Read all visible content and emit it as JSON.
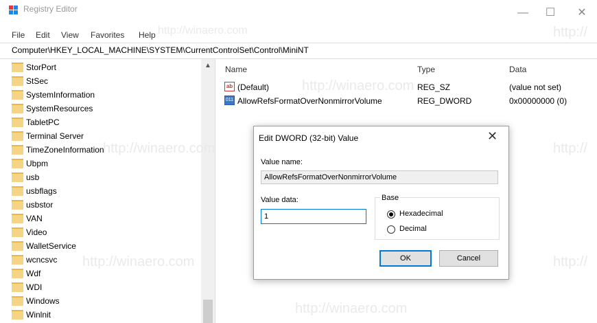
{
  "window": {
    "title": "Registry Editor",
    "minimize_glyph": "—",
    "maximize_glyph": "☐",
    "close_glyph": "✕"
  },
  "menu": [
    "File",
    "Edit",
    "View",
    "Favorites",
    "Help"
  ],
  "address": "Computer\\HKEY_LOCAL_MACHINE\\SYSTEM\\CurrentControlSet\\Control\\MiniNT",
  "tree": {
    "items": [
      "StorPort",
      "StSec",
      "SystemInformation",
      "SystemResources",
      "TabletPC",
      "Terminal Server",
      "TimeZoneInformation",
      "Ubpm",
      "usb",
      "usbflags",
      "usbstor",
      "VAN",
      "Video",
      "WalletService",
      "wcncsvc",
      "Wdf",
      "WDI",
      "Windows",
      "Winlnit"
    ],
    "scroll_up_glyph": "▲"
  },
  "values": {
    "columns": [
      "Name",
      "Type",
      "Data"
    ],
    "rows": [
      {
        "icon": "string-value-icon",
        "glyph": "ab",
        "name": "(Default)",
        "type": "REG_SZ",
        "data": "(value not set)"
      },
      {
        "icon": "dword-value-icon",
        "glyph": "011",
        "name": "AllowRefsFormatOverNonmirrorVolume",
        "type": "REG_DWORD",
        "data": "0x00000000 (0)"
      }
    ]
  },
  "dialog": {
    "title": "Edit DWORD (32-bit) Value",
    "close_glyph": "✕",
    "value_name_label": "Value name:",
    "value_name": "AllowRefsFormatOverNonmirrorVolume",
    "value_data_label": "Value data:",
    "value_data": "1",
    "base_label": "Base",
    "hex_label": "Hexadecimal",
    "dec_label": "Decimal",
    "selected_base": "Hexadecimal",
    "ok_label": "OK",
    "cancel_label": "Cancel"
  },
  "watermarks": [
    "http://winaero.com",
    "http://winaero.com",
    "http://winaero.com",
    "http://winaero.com",
    "http://winaero.com",
    "http://winaero.com",
    "http://",
    "http://",
    "http://"
  ],
  "colors": {
    "accent": "#0078d7",
    "folder": "#f5d486",
    "logo_blue": "#1e88e5",
    "logo_red": "#e53935"
  }
}
